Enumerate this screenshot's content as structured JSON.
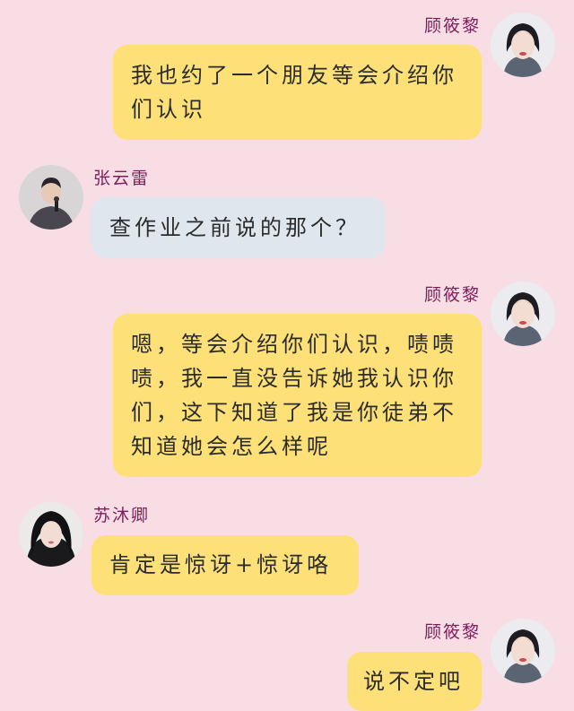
{
  "colors": {
    "background": "#f9dde5",
    "self_bubble": "#fde178",
    "other_bubble_blue": "#dfe6ee",
    "name_color": "#7a1f5c"
  },
  "messages": [
    {
      "sender": "顾筱黎",
      "side": "right",
      "text": "我也约了一个朋友等会介绍你们认识"
    },
    {
      "sender": "张云雷",
      "side": "left",
      "text": "查作业之前说的那个？"
    },
    {
      "sender": "顾筱黎",
      "side": "right",
      "text": "嗯，等会介绍你们认识，啧啧啧，我一直没告诉她我认识你们，这下知道了我是你徒弟不知道她会怎么样呢"
    },
    {
      "sender": "苏沐卿",
      "side": "left",
      "text": "肯定是惊讶+惊讶咯"
    },
    {
      "sender": "顾筱黎",
      "side": "right",
      "text": "说不定吧"
    }
  ]
}
